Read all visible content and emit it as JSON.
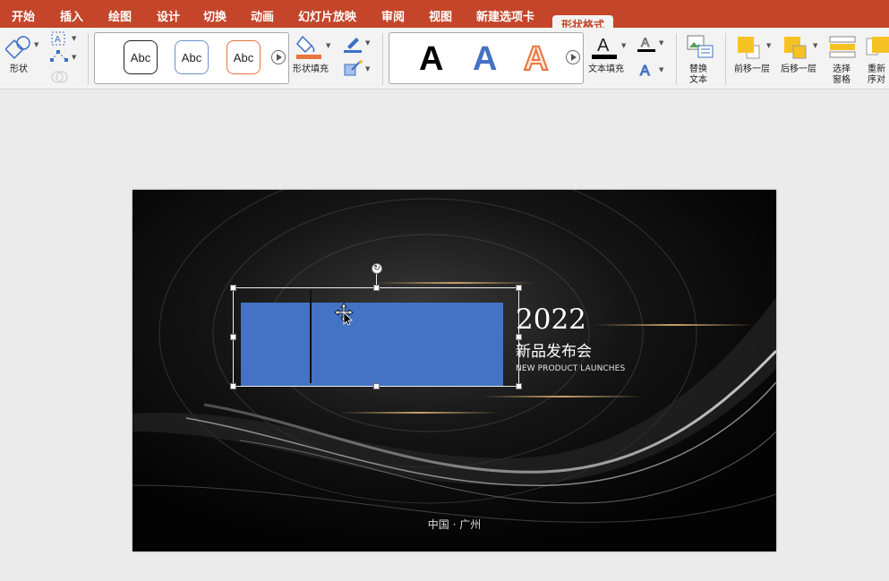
{
  "tabs": [
    "开始",
    "插入",
    "绘图",
    "设计",
    "切换",
    "动画",
    "幻灯片放映",
    "审阅",
    "视图",
    "新建选项卡"
  ],
  "active_tab": "形状格式",
  "ribbon": {
    "shape_label": "形状",
    "style_samples": [
      "Abc",
      "Abc",
      "Abc"
    ],
    "shape_fill_label": "形状填充",
    "wordart_letter": "A",
    "text_fill_label": "文本填充",
    "alt_text_label": [
      "替换",
      "文本"
    ],
    "bring_forward_label": "前移一层",
    "send_backward_label": "后移一层",
    "selection_pane_label": [
      "选择",
      "窗格"
    ],
    "reorder_label": [
      "重新",
      "序对"
    ]
  },
  "slide": {
    "year": "2022",
    "subtitle": "新品发布会",
    "english_title": "NEW PRODUCT LAUNCHES",
    "footer": "中国 · 广州"
  },
  "colors": {
    "tab_bar": "#c4452a",
    "ribbon_bg": "#f3f3f3",
    "canvas_bg": "#ebebeb",
    "shape_fill": "#4472c4",
    "accent_orange": "#e8753f",
    "gold_line": "#c9a36a"
  },
  "icons": {
    "rotate": "rotate-handle-icon",
    "move": "move-cursor-icon"
  }
}
